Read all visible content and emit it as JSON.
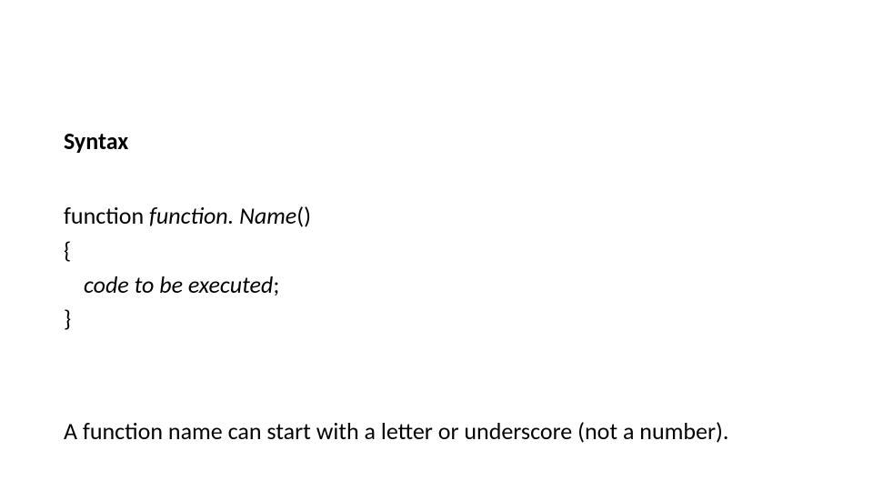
{
  "heading": "Syntax",
  "code": {
    "line1_pre": "function ",
    "line1_name": "function. Name",
    "line1_post": "()",
    "line2": "{",
    "line3_pre": "",
    "line3_code": "code to be executed",
    "line3_post": ";",
    "line4": "}"
  },
  "note": "A function name can start with a letter or underscore (not a number)."
}
